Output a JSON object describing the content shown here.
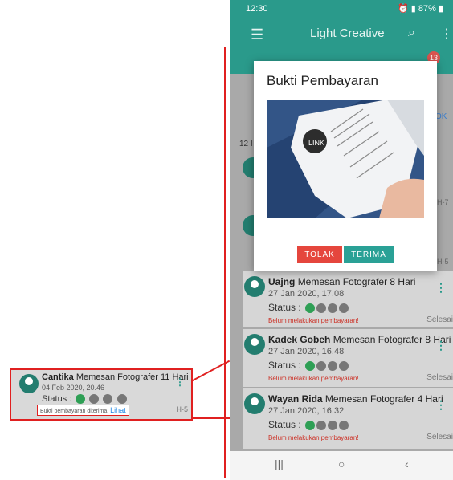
{
  "statusbar": {
    "time": "12:30",
    "battery": "87%"
  },
  "appbar": {
    "title": "Light Creative",
    "menu_icon": "menu-icon",
    "search_icon": "search-icon",
    "more_icon": "more-vertical-icon"
  },
  "tabbar": {
    "badge_count": "13"
  },
  "dialog": {
    "title": "Bukti Pembayaran",
    "reject_label": "TOLAK",
    "accept_label": "TERIMA"
  },
  "behind_dialog": {
    "count_prefix": "12 I",
    "action_label": "OK",
    "h7": "H-7",
    "h5": "H-5"
  },
  "orders": [
    {
      "name": "Uajng",
      "action": "Memesan Fotografer 8 Hari",
      "date": "27 Jan 2020, 17.08",
      "status_label": "Status :",
      "warning": "Belum melakukan pembayaran!",
      "tail": "Selesai"
    },
    {
      "name": "Kadek Gobeh",
      "action": "Memesan Fotografer 8 Hari",
      "date": "27 Jan 2020, 16.48",
      "status_label": "Status :",
      "warning": "Belum melakukan pembayaran!",
      "tail": "Selesai"
    },
    {
      "name": "Wayan Rida",
      "action": "Memesan Fotografer 4 Hari",
      "date": "27 Jan 2020, 16.32",
      "status_label": "Status :",
      "warning": "Belum melakukan pembayaran!",
      "tail": "Selesai"
    }
  ],
  "zoom": {
    "name": "Cantika",
    "action": "Memesan Fotografer 11 Hari",
    "date": "04 Feb 2020, 20.46",
    "status_label": "Status :",
    "note": "Bukti pembayaran diterima.",
    "link": "Lihat",
    "tail": "H-5"
  },
  "receipt_text": "LINK",
  "colors": {
    "primary": "#2a9a8b",
    "reject": "#e5463d",
    "accept": "#2aa196",
    "callout": "#e02020"
  }
}
